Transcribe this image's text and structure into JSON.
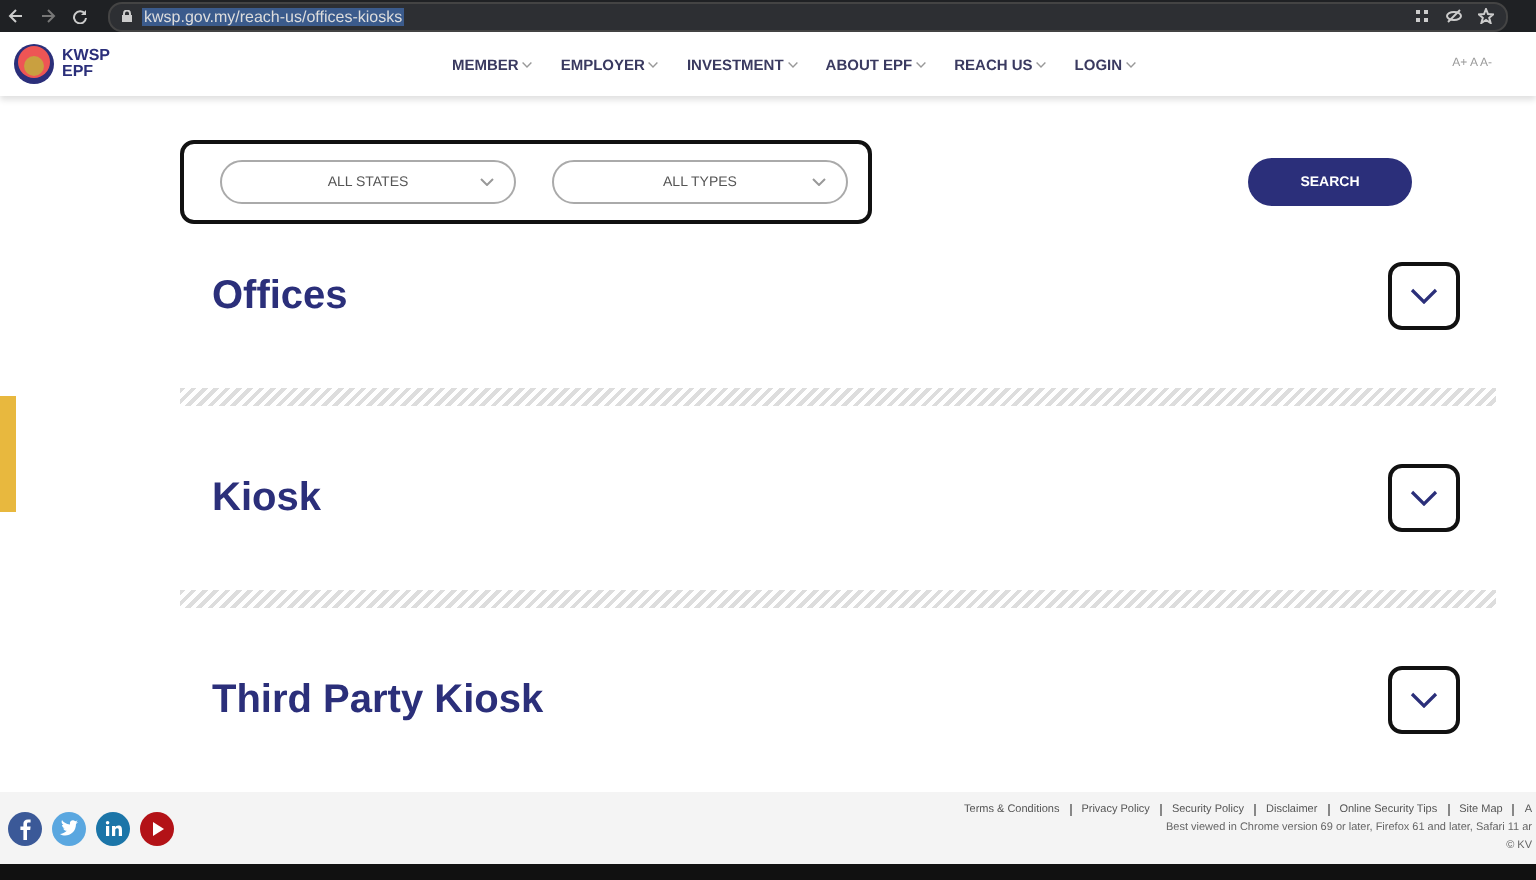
{
  "browser": {
    "url": "kwsp.gov.my/reach-us/offices-kiosks"
  },
  "header": {
    "logo_line1": "KWSP",
    "logo_line2": "EPF",
    "nav": [
      "MEMBER",
      "EMPLOYER",
      "INVESTMENT",
      "ABOUT EPF",
      "REACH US",
      "LOGIN"
    ],
    "font_size": "A+ A A-"
  },
  "filters": {
    "dropdowns": [
      "ALL STATES",
      "ALL TYPES"
    ],
    "search_button": "SEARCH"
  },
  "sections": [
    {
      "title": "Offices",
      "expanded": false
    },
    {
      "title": "Kiosk",
      "expanded": false
    },
    {
      "title": "Third Party Kiosk",
      "expanded": false
    }
  ],
  "footer": {
    "links": [
      "Terms & Conditions",
      "Privacy Policy",
      "Security Policy",
      "Disclaimer",
      "Online Security Tips",
      "Site Map",
      "A"
    ],
    "note": "Best viewed in Chrome version 69 or later, Firefox 61 and later, Safari 11 ar",
    "copyright": "© KV"
  }
}
